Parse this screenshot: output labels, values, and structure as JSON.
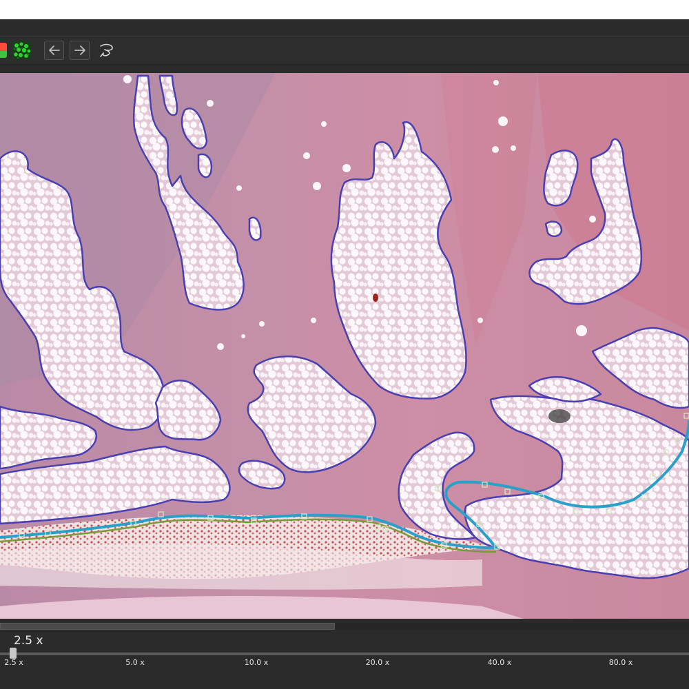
{
  "toolbar": {
    "tools": [
      {
        "name": "color-swatch-tool",
        "icon": "red-green-swatch-icon"
      },
      {
        "name": "tissue-detect-tool",
        "icon": "green-cells-icon"
      },
      {
        "name": "undo-button",
        "icon": "arrow-left-icon"
      },
      {
        "name": "redo-button",
        "icon": "arrow-right-icon"
      },
      {
        "name": "lasso-tool-button",
        "icon": "lasso-icon"
      }
    ]
  },
  "viewer": {
    "content": "H&E stained tissue slide with fat region annotations",
    "annotation_colors": {
      "region_outline": "#4a3fb0",
      "line_outer": "#2aa0c8",
      "line_inner": "#7a9a3a"
    }
  },
  "zoom": {
    "current": "2.5 x",
    "level_fraction": 0.0,
    "ticks": [
      "2.5 x",
      "5.0 x",
      "10.0 x",
      "20.0 x",
      "40.0 x",
      "80.0 x"
    ]
  }
}
